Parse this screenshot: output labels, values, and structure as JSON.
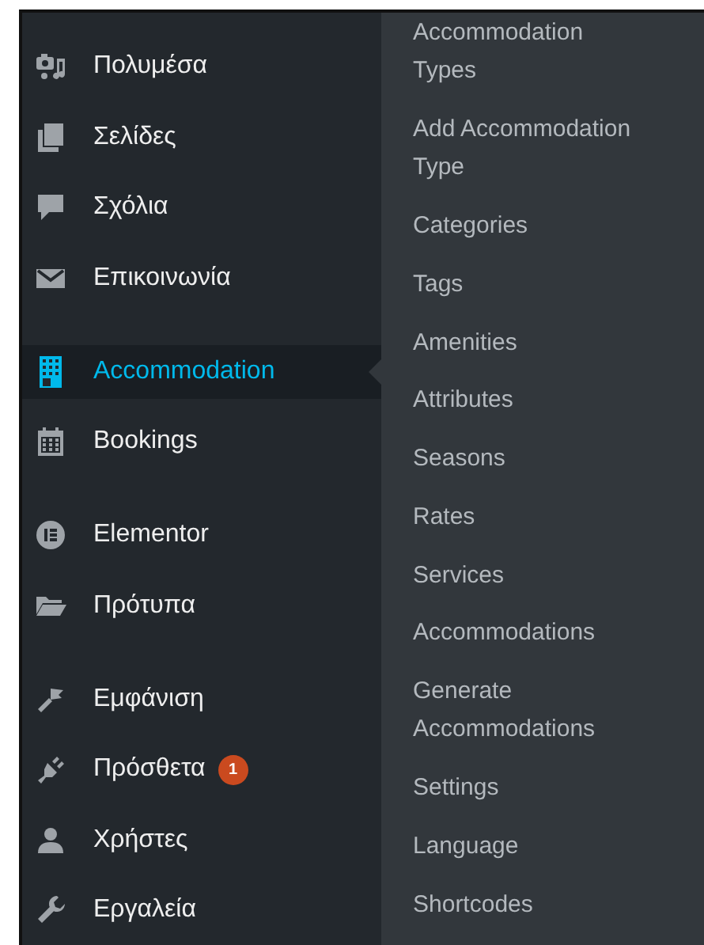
{
  "menu_groups": [
    [
      {
        "label": "Πολυμέσα",
        "selected": false
      },
      {
        "label": "Σελίδες",
        "selected": false
      },
      {
        "label": "Σχόλια",
        "selected": false
      },
      {
        "label": "Επικοινωνία",
        "selected": false
      }
    ],
    [
      {
        "label": "Accommodation",
        "selected": true
      },
      {
        "label": "Bookings",
        "selected": false
      }
    ],
    [
      {
        "label": "Elementor",
        "selected": false
      },
      {
        "label": "Πρότυπα",
        "selected": false
      }
    ],
    [
      {
        "label": "Εμφάνιση",
        "selected": false
      },
      {
        "label": "Πρόσθετα",
        "selected": false,
        "badge": "1"
      },
      {
        "label": "Χρήστες",
        "selected": false
      },
      {
        "label": "Εργαλεία",
        "selected": false
      }
    ]
  ],
  "submenu": [
    "Accommodation Types",
    "Add Accommodation Type",
    "Categories",
    "Tags",
    "Amenities",
    "Attributes",
    "Seasons",
    "Rates",
    "Services",
    "Accommodations",
    "Generate Accommodations",
    "Settings",
    "Language",
    "Shortcodes"
  ]
}
